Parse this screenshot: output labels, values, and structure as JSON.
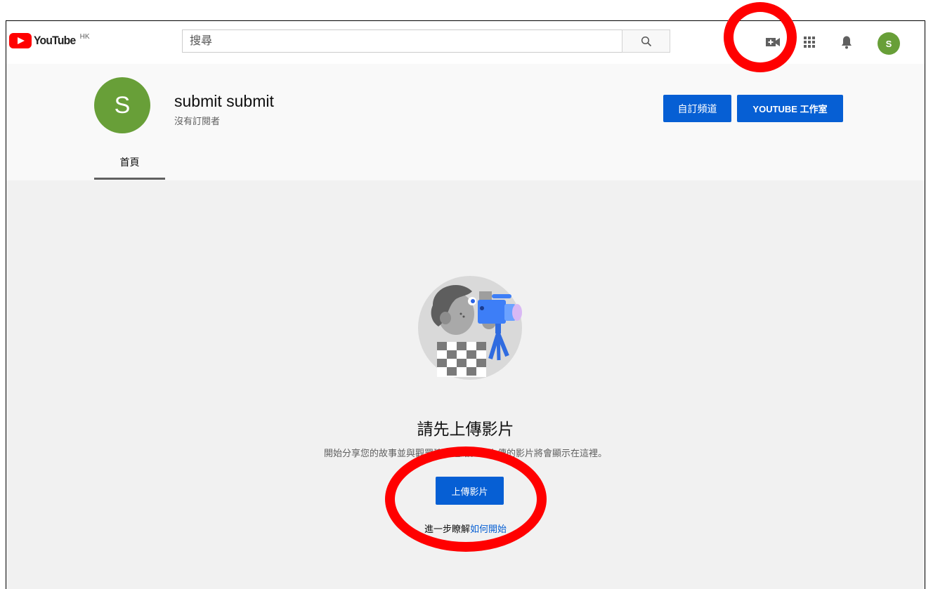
{
  "masthead": {
    "logo_word": "YouTube",
    "logo_country": "HK",
    "search_placeholder": "搜尋",
    "avatar_letter": "S"
  },
  "channel": {
    "avatar_letter": "S",
    "name": "submit submit",
    "subscribers": "沒有訂閱者",
    "customize_label": "自訂頻道",
    "studio_label": "YOUTUBE 工作室",
    "tabs": [
      {
        "label": "首頁"
      }
    ]
  },
  "empty_state": {
    "title": "請先上傳影片",
    "description": "開始分享您的故事並與觀眾建立連結。您上傳的影片將會顯示在這裡。",
    "upload_label": "上傳影片",
    "learn_more_prefix": "進一步瞭解",
    "learn_more_link": "如何開始"
  },
  "colors": {
    "brand_red": "#ff0000",
    "accent_blue": "#065fd4",
    "avatar_green": "#689f38",
    "annotation_red": "#ff0000"
  },
  "icons": [
    "youtube-logo-icon",
    "search-icon",
    "create-video-icon",
    "apps-grid-icon",
    "notifications-bell-icon"
  ]
}
